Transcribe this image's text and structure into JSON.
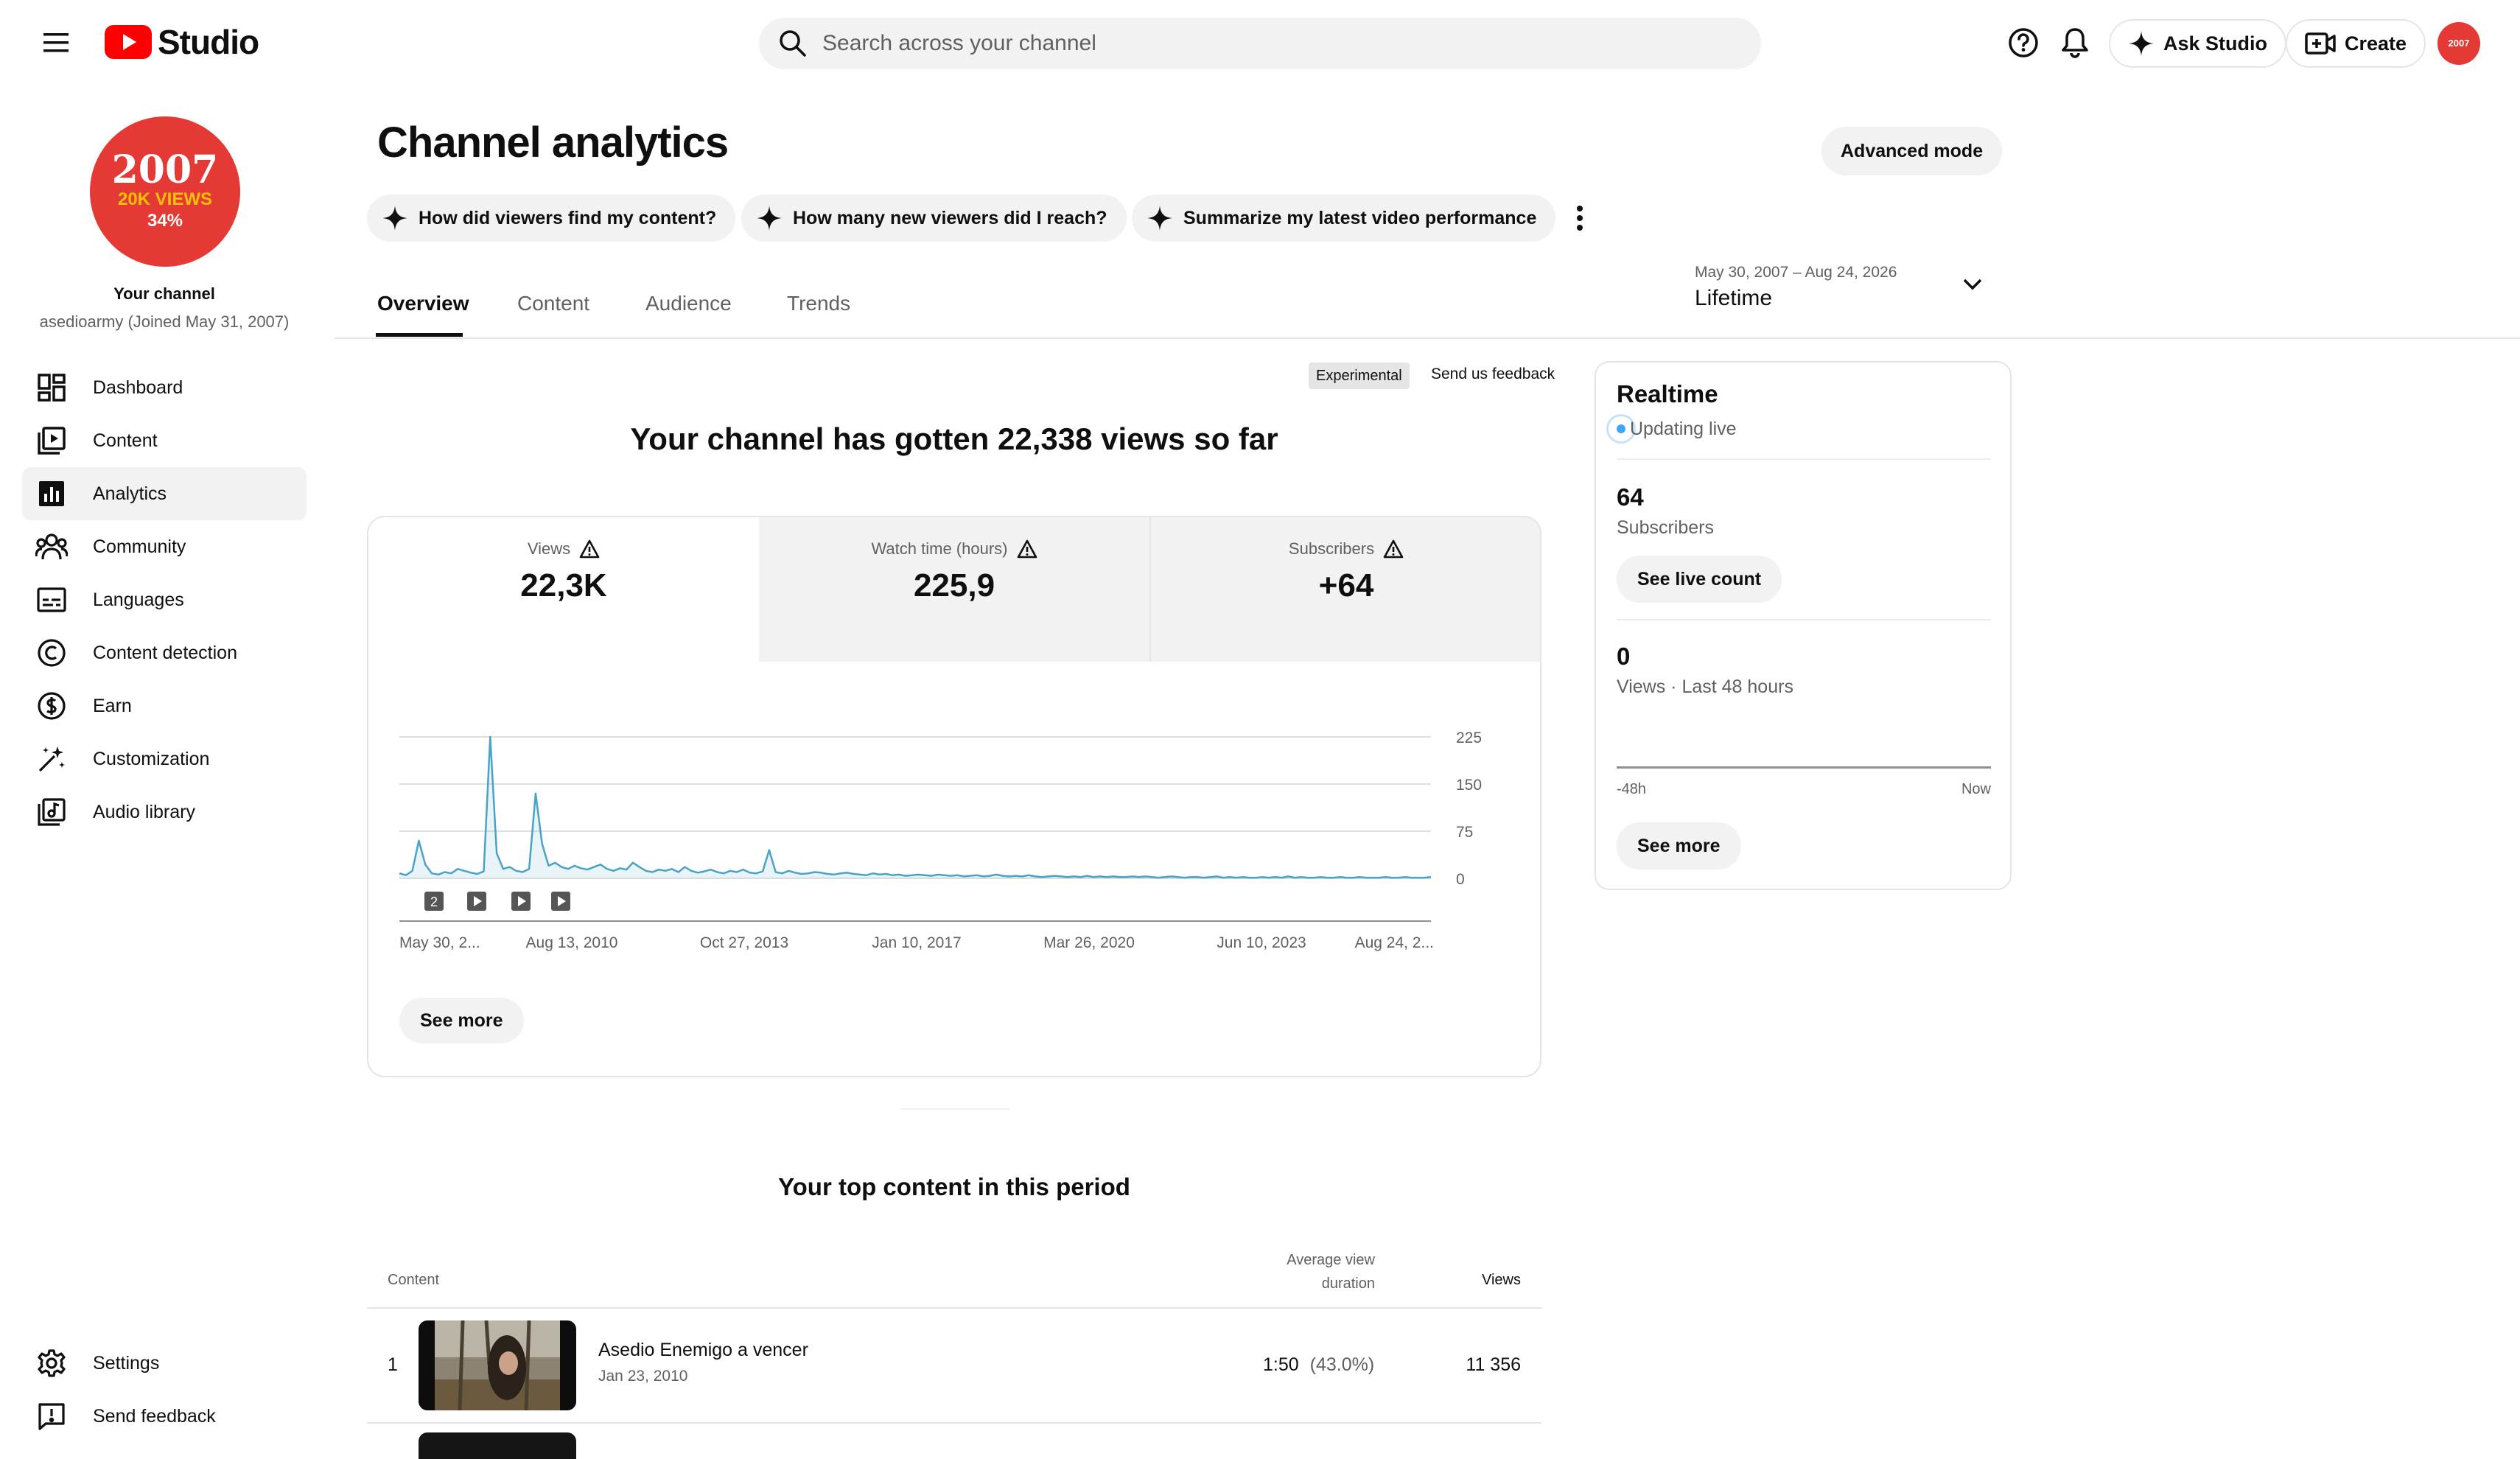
{
  "header": {
    "logo_text": "Studio",
    "search_placeholder": "Search across your channel",
    "ask_studio_label": "Ask Studio",
    "create_label": "Create",
    "avatar_text": "2007"
  },
  "sidebar": {
    "avatar": {
      "year": "2007",
      "views": "20K VIEWS",
      "pct": "34%"
    },
    "your_channel_label": "Your channel",
    "channel_subtitle": "asedioarmy (Joined May 31, 2007)",
    "items": [
      {
        "label": "Dashboard",
        "icon": "dashboard-icon"
      },
      {
        "label": "Content",
        "icon": "content-icon"
      },
      {
        "label": "Analytics",
        "icon": "analytics-icon",
        "active": true
      },
      {
        "label": "Community",
        "icon": "community-icon"
      },
      {
        "label": "Languages",
        "icon": "subtitles-icon"
      },
      {
        "label": "Content detection",
        "icon": "copyright-icon"
      },
      {
        "label": "Earn",
        "icon": "dollar-icon"
      },
      {
        "label": "Customization",
        "icon": "magic-wand-icon"
      },
      {
        "label": "Audio library",
        "icon": "audio-library-icon"
      }
    ],
    "footer_items": [
      {
        "label": "Settings",
        "icon": "gear-icon"
      },
      {
        "label": "Send feedback",
        "icon": "feedback-icon"
      }
    ]
  },
  "main": {
    "title": "Channel analytics",
    "advanced_mode_label": "Advanced mode",
    "chips": [
      "How did viewers find my content?",
      "How many new viewers did I reach?",
      "Summarize my latest video performance"
    ],
    "tabs": [
      "Overview",
      "Content",
      "Audience",
      "Trends"
    ],
    "active_tab": "Overview",
    "date_range": "May 30, 2007 – Aug 24, 2026",
    "date_label": "Lifetime",
    "experimental_label": "Experimental",
    "feedback_label": "Send us feedback",
    "headline": "Your channel has gotten 22,338 views so far",
    "metrics": [
      {
        "label": "Views",
        "value": "22,3K",
        "selected": true
      },
      {
        "label": "Watch time (hours)",
        "value": "225,9"
      },
      {
        "label": "Subscribers",
        "value": "+64"
      }
    ],
    "see_more_label": "See more",
    "top_content_title": "Your top content in this period",
    "table": {
      "headers": {
        "content": "Content",
        "avg_line1": "Average view",
        "avg_line2": "duration",
        "views": "Views"
      },
      "rows": [
        {
          "rank": "1",
          "title": "Asedio Enemigo a vencer",
          "date": "Jan 23, 2010",
          "avg": "1:50",
          "avg_pct": "(43.0%)",
          "views": "11 356"
        }
      ]
    }
  },
  "realtime": {
    "title": "Realtime",
    "status": "Updating live",
    "subscribers_value": "64",
    "subscribers_label": "Subscribers",
    "see_live_count_label": "See live count",
    "views_value": "0",
    "views_label": "Views · Last 48 hours",
    "axis_start": "-48h",
    "axis_end": "Now",
    "see_more_label": "See more"
  },
  "chart_data": {
    "type": "line",
    "series": [
      {
        "values": [
          8,
          5,
          12,
          60,
          22,
          8,
          6,
          10,
          8,
          15,
          12,
          9,
          7,
          11,
          225,
          40,
          15,
          18,
          12,
          10,
          15,
          135,
          55,
          20,
          25,
          18,
          15,
          20,
          16,
          14,
          18,
          22,
          15,
          12,
          16,
          14,
          25,
          18,
          12,
          10,
          14,
          12,
          15,
          10,
          18,
          12,
          9,
          11,
          14,
          10,
          8,
          12,
          10,
          14,
          9,
          8,
          11,
          45,
          10,
          8,
          12,
          9,
          7,
          8,
          10,
          9,
          7,
          6,
          8,
          9,
          7,
          6,
          5,
          8,
          6,
          7,
          5,
          6,
          4,
          5,
          6,
          5,
          4,
          6,
          5,
          4,
          5,
          3,
          4,
          5,
          3,
          4,
          6,
          4,
          3,
          4,
          3,
          5,
          3,
          2,
          3,
          4,
          3,
          2,
          3,
          2,
          4,
          2,
          3,
          2,
          3,
          2,
          2,
          3,
          2,
          3,
          2,
          1,
          2,
          3,
          2,
          1,
          2,
          2,
          1,
          2,
          3,
          1,
          2,
          1,
          2,
          1,
          1,
          2,
          1,
          2,
          1,
          3,
          1,
          2,
          1,
          1,
          2,
          1,
          1,
          2,
          1,
          1,
          2,
          1,
          1,
          1,
          2,
          1,
          1,
          2,
          1,
          1,
          1,
          2
        ]
      }
    ],
    "x_tick_labels": [
      "May 30, 2...",
      "Aug 13, 2010",
      "Oct 27, 2013",
      "Jan 10, 2017",
      "Mar 26, 2020",
      "Jun 10, 2023",
      "Aug 24, 2..."
    ],
    "y_ticks": [
      0,
      75,
      150,
      225
    ],
    "ylim": [
      0,
      225
    ],
    "grid": true,
    "markers": [
      "2",
      "play",
      "play",
      "play"
    ],
    "color": "#4aa3c7"
  }
}
